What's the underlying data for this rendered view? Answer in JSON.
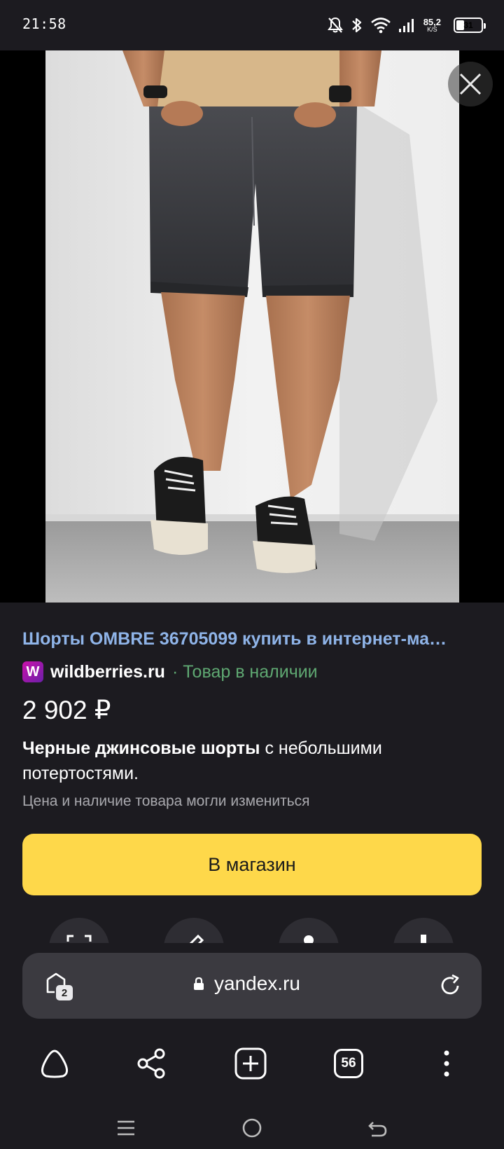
{
  "status_bar": {
    "time": "21:58",
    "net_speed_value": "85,2",
    "net_speed_unit": "K/S",
    "battery_level": "31",
    "battery_fraction": 0.31
  },
  "viewer": {
    "close_icon": "close-icon"
  },
  "result": {
    "title": "Шорты OMBRE 36705099 купить в интернет-ма…",
    "source_logo_letter": "W",
    "source_name": "wildberries.ru",
    "stock_status": "· Товар в наличии",
    "price": "2 902 ₽",
    "description_bold": "Черные джинсовые шорты",
    "description_rest": " с небольшими потертостями.",
    "disclaimer": "Цена и наличие товара могли измениться",
    "shop_button_label": "В магазин"
  },
  "address_bar": {
    "tab_group_count": "2",
    "url": "yandex.ru"
  },
  "toolbar": {
    "tabs_count": "56"
  },
  "colors": {
    "background": "#1c1b20",
    "link": "#8fb4e8",
    "stock": "#5fa872",
    "button": "#fed84a",
    "address_bar": "#3b3a40"
  }
}
